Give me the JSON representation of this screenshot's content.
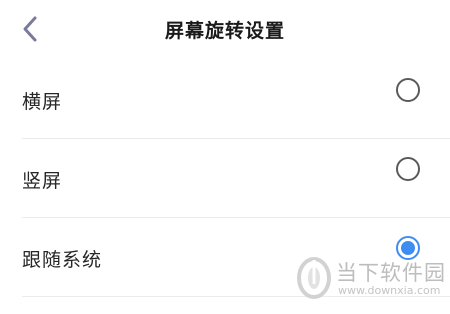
{
  "header": {
    "title": "屏幕旋转设置",
    "back_icon": "chevron-left-icon"
  },
  "options": [
    {
      "label": "横屏",
      "selected": false
    },
    {
      "label": "竖屏",
      "selected": false
    },
    {
      "label": "跟随系统",
      "selected": true
    }
  ],
  "colors": {
    "accent": "#3f8cf2",
    "radio_off": "#5a5a5a",
    "divider": "#ececec"
  },
  "watermark": {
    "name": "当下软件园",
    "url": "www.downxia.com",
    "icon": "downxia-logo-icon"
  }
}
